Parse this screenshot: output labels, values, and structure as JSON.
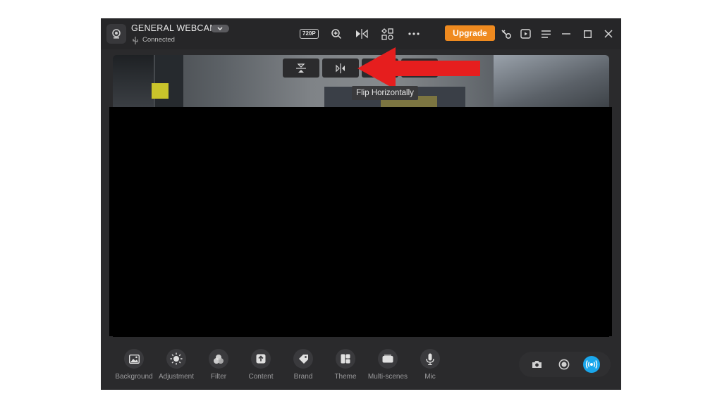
{
  "titlebar": {
    "camera_name": "GENERAL WEBCAM",
    "status": "Connected",
    "resolution": "720P",
    "upgrade_label": "Upgrade"
  },
  "video": {
    "tooltip": "Flip Horizontally"
  },
  "bottom_bar": {
    "items": [
      {
        "label": "Background",
        "icon": "image-icon"
      },
      {
        "label": "Adjustment",
        "icon": "brightness-icon"
      },
      {
        "label": "Filter",
        "icon": "filter-icon"
      },
      {
        "label": "Content",
        "icon": "upload-icon"
      },
      {
        "label": "Brand",
        "icon": "tag-icon"
      },
      {
        "label": "Theme",
        "icon": "layout-icon"
      },
      {
        "label": "Multi-scenes",
        "icon": "scenes-icon"
      },
      {
        "label": "Mic",
        "icon": "mic-icon"
      }
    ]
  },
  "colors": {
    "accent": "#ef8a1f",
    "live": "#1aa7ec",
    "annotation_arrow": "#e61e1e"
  }
}
